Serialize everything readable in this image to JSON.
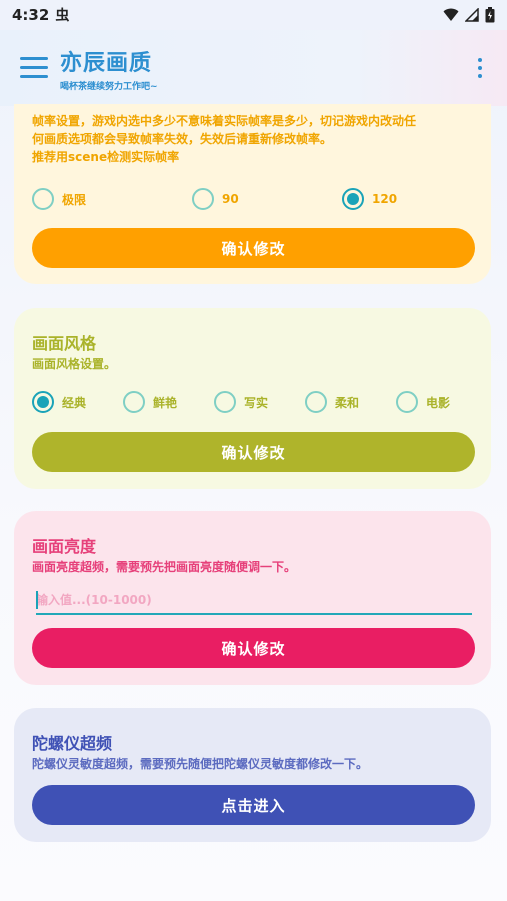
{
  "status": {
    "time": "4:32",
    "bug_glyph": "虫"
  },
  "header": {
    "title": "亦辰画质",
    "subtitle": "喝杯茶继续努力工作吧~"
  },
  "framerate": {
    "desc_line1": "帧率设置，游戏内选中多少不意味着实际帧率是多少，切记游戏内改动任",
    "desc_line2": "何画质选项都会导致帧率失效，失效后请重新修改帧率。",
    "desc_line3": "推荐用scene检测实际帧率",
    "options": [
      "极限",
      "90",
      "120"
    ],
    "selected": "120",
    "button": "确认修改",
    "text_color": "#f0a500",
    "button_color": "#ffa000"
  },
  "style": {
    "title": "画面风格",
    "desc": "画面风格设置。",
    "options": [
      "经典",
      "鲜艳",
      "写实",
      "柔和",
      "电影"
    ],
    "selected": "经典",
    "button": "确认修改",
    "text_color": "#aab32a",
    "button_color": "#afb42b"
  },
  "brightness": {
    "title": "画面亮度",
    "desc": "画面亮度超频，需要预先把画面亮度随便调一下。",
    "placeholder": "输入值...(10-1000)",
    "button": "确认修改",
    "text_color": "#e6407a",
    "button_color": "#e91e63"
  },
  "gyro": {
    "title": "陀螺仪超频",
    "desc": "陀螺仪灵敏度超频，需要预先随便把陀螺仪灵敏度都修改一下。",
    "button": "点击进入",
    "text_color": "#3f51b5",
    "button_color": "#3f51b5"
  },
  "icons": {
    "menu": "menu-icon",
    "more": "more-vert-icon",
    "wifi": "wifi-icon",
    "signal": "signal-icon",
    "battery": "battery-icon"
  }
}
